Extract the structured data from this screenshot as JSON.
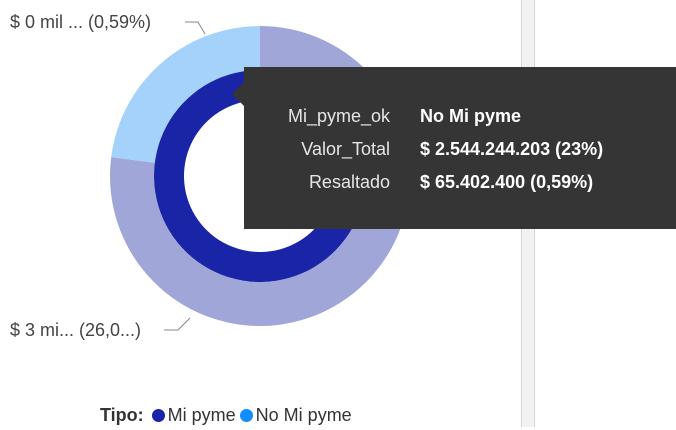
{
  "chart_data": {
    "type": "donut",
    "outer_ring": {
      "categories": [
        "Mi pyme",
        "No Mi pyme"
      ],
      "values": [
        77,
        23
      ],
      "colors": [
        "#a1a6d8",
        "#a5d2fb"
      ]
    },
    "inner_ring": {
      "categories": [
        "Mi pyme",
        "No Mi pyme"
      ],
      "values": [
        99.41,
        0.59
      ],
      "colors": [
        "#1a24a6",
        "#118dff"
      ]
    },
    "data_labels": [
      {
        "text": "$ 0 mil ... (0,59%)"
      },
      {
        "text": "$ 3 mi... (26,0...)"
      }
    ]
  },
  "tooltip": {
    "rows": [
      {
        "key": "Mi_pyme_ok",
        "value": "No Mi pyme"
      },
      {
        "key": "Valor_Total",
        "value": "$ 2.544.244.203 (23%)"
      },
      {
        "key": "Resaltado",
        "value": "$ 65.402.400 (0,59%)"
      }
    ]
  },
  "legend": {
    "title": "Tipo:",
    "items": [
      {
        "label": "Mi pyme",
        "color": "#1a24a6"
      },
      {
        "label": "No Mi pyme",
        "color": "#118dff"
      }
    ]
  }
}
